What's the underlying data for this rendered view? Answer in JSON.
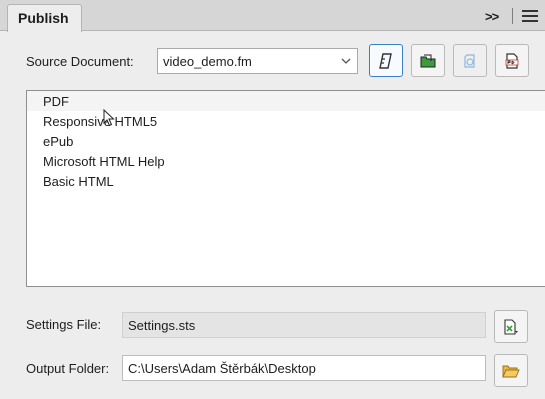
{
  "panel": {
    "tab_title": "Publish",
    "expand_glyph": ">>",
    "expand_icon": "double-chevron-right-icon",
    "menu_icon": "hamburger-menu-icon"
  },
  "source": {
    "label": "Source Document:",
    "selected": "video_demo.fm",
    "toolbar_icons": [
      "generate-icon",
      "open-folder-icon",
      "view-output-icon",
      "pdf-settings-icon"
    ]
  },
  "outputs": {
    "items": [
      "PDF",
      "Responsive HTML5",
      "ePub",
      "Microsoft HTML Help",
      "Basic HTML"
    ]
  },
  "settings_file": {
    "label": "Settings File:",
    "value": "Settings.sts",
    "button_icon": "file-settings-icon"
  },
  "output_folder": {
    "label": "Output Folder:",
    "value": "C:\\Users\\Adam Štěrbák\\Desktop",
    "button_icon": "browse-folder-icon"
  },
  "colors": {
    "accent": "#3a7fc3",
    "folder_yellow": "#e8b84a",
    "icon_green": "#3d9b3d"
  }
}
